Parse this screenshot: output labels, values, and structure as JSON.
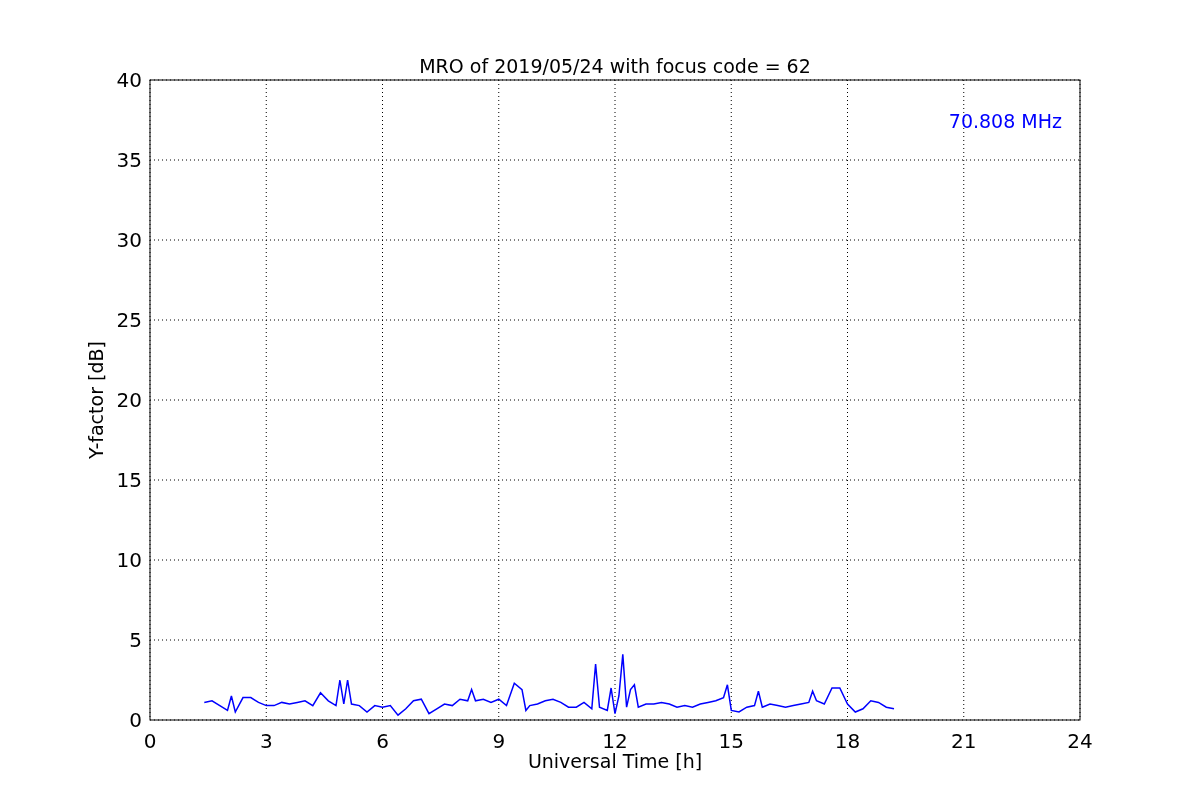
{
  "chart_data": {
    "type": "line",
    "title": "MRO of 2019/05/24 with focus code = 62",
    "xlabel": "Universal Time [h]",
    "ylabel": "Y-factor [dB]",
    "x": [
      1.4,
      1.6,
      1.8,
      2.0,
      2.1,
      2.2,
      2.4,
      2.6,
      2.8,
      3.0,
      3.2,
      3.4,
      3.6,
      3.8,
      4.0,
      4.2,
      4.4,
      4.6,
      4.8,
      4.9,
      5.0,
      5.1,
      5.2,
      5.4,
      5.6,
      5.8,
      6.0,
      6.2,
      6.4,
      6.6,
      6.8,
      7.0,
      7.2,
      7.4,
      7.6,
      7.8,
      8.0,
      8.2,
      8.3,
      8.4,
      8.6,
      8.8,
      9.0,
      9.2,
      9.4,
      9.6,
      9.7,
      9.8,
      10.0,
      10.2,
      10.4,
      10.6,
      10.8,
      11.0,
      11.2,
      11.4,
      11.5,
      11.6,
      11.8,
      11.9,
      12.0,
      12.1,
      12.2,
      12.3,
      12.4,
      12.5,
      12.6,
      12.8,
      13.0,
      13.2,
      13.4,
      13.6,
      13.8,
      14.0,
      14.2,
      14.4,
      14.6,
      14.8,
      14.9,
      15.0,
      15.2,
      15.4,
      15.6,
      15.7,
      15.8,
      16.0,
      16.2,
      16.4,
      16.6,
      16.8,
      17.0,
      17.1,
      17.2,
      17.4,
      17.6,
      17.8,
      18.0,
      18.2,
      18.4,
      18.6,
      18.8,
      19.0,
      19.2
    ],
    "series": [
      {
        "name": "70.808 MHz",
        "color": "#0000ff",
        "values": [
          1.1,
          1.2,
          0.9,
          0.6,
          1.5,
          0.5,
          1.4,
          1.4,
          1.1,
          0.9,
          0.9,
          1.1,
          1.0,
          1.1,
          1.2,
          0.9,
          1.7,
          1.2,
          0.9,
          2.5,
          1.0,
          2.5,
          1.0,
          0.9,
          0.5,
          0.9,
          0.8,
          0.9,
          0.3,
          0.7,
          1.2,
          1.3,
          0.4,
          0.7,
          1.0,
          0.9,
          1.3,
          1.2,
          1.9,
          1.2,
          1.3,
          1.1,
          1.3,
          0.9,
          2.3,
          1.9,
          0.6,
          0.9,
          1.0,
          1.2,
          1.3,
          1.1,
          0.8,
          0.8,
          1.1,
          0.7,
          3.5,
          0.8,
          0.6,
          2.0,
          0.4,
          1.5,
          4.1,
          0.8,
          1.9,
          2.2,
          0.8,
          1.0,
          1.0,
          1.1,
          1.0,
          0.8,
          0.9,
          0.8,
          1.0,
          1.1,
          1.2,
          1.4,
          2.2,
          0.6,
          0.5,
          0.8,
          0.9,
          1.8,
          0.8,
          1.0,
          0.9,
          0.8,
          0.9,
          1.0,
          1.1,
          1.8,
          1.2,
          1.0,
          2.0,
          2.0,
          1.0,
          0.5,
          0.7,
          1.2,
          1.1,
          0.8,
          0.7
        ]
      }
    ],
    "xlim": [
      0,
      24
    ],
    "ylim": [
      0,
      40
    ],
    "xticks": [
      0,
      3,
      6,
      9,
      12,
      15,
      18,
      21,
      24
    ],
    "yticks": [
      0,
      5,
      10,
      15,
      20,
      25,
      30,
      35,
      40
    ],
    "grid": true
  }
}
